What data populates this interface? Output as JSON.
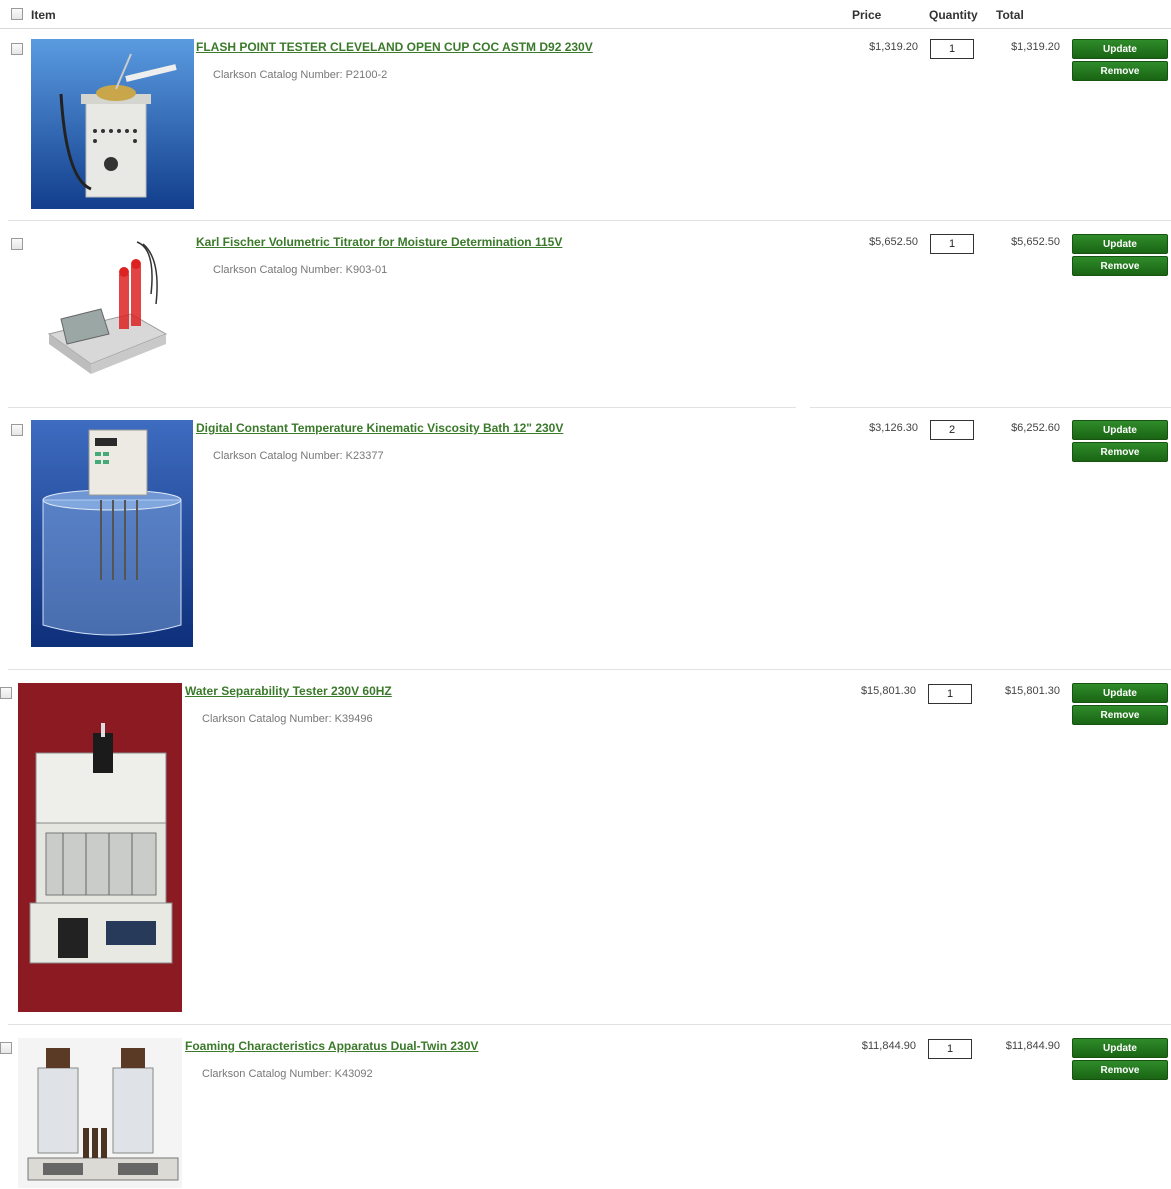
{
  "header": {
    "item_label": "Item",
    "price_label": "Price",
    "quantity_label": "Quantity",
    "total_label": "Total"
  },
  "buttons": {
    "update_label": "Update",
    "remove_label": "Remove"
  },
  "catalog_prefix": "Clarkson Catalog Number:",
  "colors": {
    "link": "#3a7a2a",
    "button": "#1f7019"
  },
  "items": [
    {
      "title": "FLASH POINT TESTER CLEVELAND OPEN CUP COC ASTM D92 230V",
      "catalog": "Clarkson Catalog Number: P2100-2",
      "price": "$1,319.20",
      "quantity": "1",
      "total": "$1,319.20"
    },
    {
      "title": "Karl Fischer Volumetric Titrator for Moisture Determination 115V",
      "catalog": "Clarkson Catalog Number: K903-01",
      "price": "$5,652.50",
      "quantity": "1",
      "total": "$5,652.50"
    },
    {
      "title": "Digital Constant Temperature Kinematic Viscosity Bath 12\" 230V",
      "catalog": "Clarkson Catalog Number: K23377",
      "price": "$3,126.30",
      "quantity": "2",
      "total": "$6,252.60"
    },
    {
      "title": "Water Separability Tester 230V 60HZ",
      "catalog": "Clarkson Catalog Number: K39496",
      "price": "$15,801.30",
      "quantity": "1",
      "total": "$15,801.30"
    },
    {
      "title": "Foaming Characteristics Apparatus Dual-Twin 230V",
      "catalog": "Clarkson Catalog Number: K43092",
      "price": "$11,844.90",
      "quantity": "1",
      "total": "$11,844.90"
    }
  ]
}
